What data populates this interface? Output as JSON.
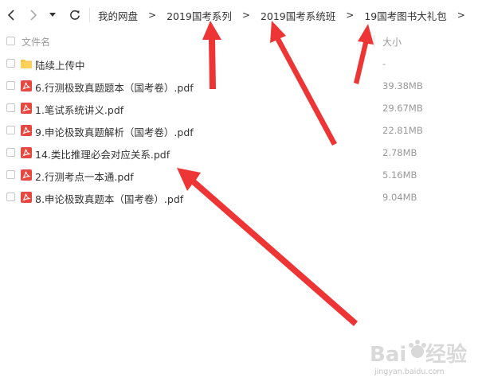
{
  "toolbar": {
    "icons": [
      "back-arrow-icon",
      "forward-arrow-icon",
      "dropdown-caret-icon",
      "refresh-icon"
    ]
  },
  "breadcrumb": {
    "items": [
      "我的网盘",
      "2019国考系列",
      "2019国考系统班",
      "19国考图书大礼包"
    ],
    "separator": ">"
  },
  "columns": {
    "name": "文件名",
    "size": "大小"
  },
  "files": [
    {
      "name": "陆续上传中",
      "size": "-",
      "type": "folder"
    },
    {
      "name": "6.行测极致真题题本（国考卷）.pdf",
      "size": "39.38MB",
      "type": "pdf"
    },
    {
      "name": "1.笔试系统讲义.pdf",
      "size": "29.67MB",
      "type": "pdf"
    },
    {
      "name": "9.申论极致真题解析（国考卷）.pdf",
      "size": "22.81MB",
      "type": "pdf"
    },
    {
      "name": "14.类比推理必会对应关系.pdf",
      "size": "2.78MB",
      "type": "pdf"
    },
    {
      "name": "2.行测考点一本通.pdf",
      "size": "5.16MB",
      "type": "pdf"
    },
    {
      "name": "8.申论极致真题本（国考卷）.pdf",
      "size": "9.04MB",
      "type": "pdf"
    }
  ],
  "colors": {
    "pdf_icon": "#e8473f",
    "folder_icon": "#f7c443",
    "annotation_arrow": "#ee3535"
  },
  "watermark": {
    "brand": "Bai du 经验",
    "url": "jingyan.baidu.com"
  }
}
